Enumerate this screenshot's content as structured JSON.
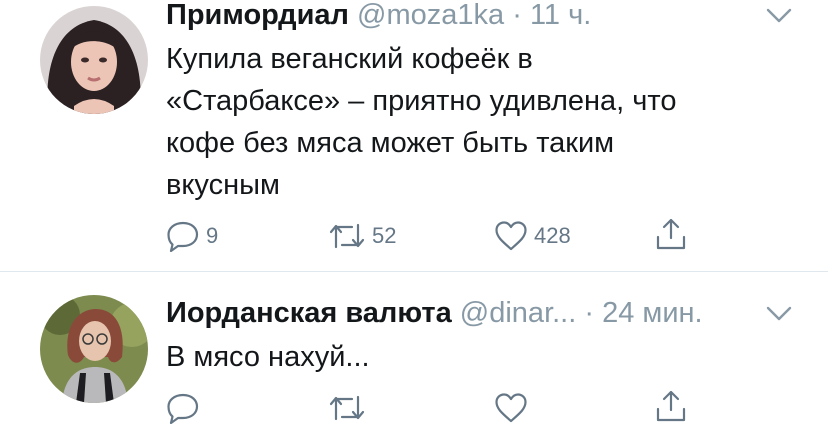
{
  "tweets": [
    {
      "author_name": "Примордиал",
      "handle": "@moza1ka",
      "separator": "·",
      "time": "11 ч.",
      "text_lines": [
        "Купила веганский кофеёк в",
        "«Старбаксе» – приятно удивлена, что",
        "кофе без мяса может быть таким",
        "вкусным"
      ],
      "actions": {
        "reply_count": "9",
        "retweet_count": "52",
        "like_count": "428"
      }
    },
    {
      "author_name": "Иорданская валюта",
      "handle": "@dinar...",
      "separator": "·",
      "time": "24 мин.",
      "text_lines": [
        "В мясо нахуй..."
      ],
      "actions": {
        "reply_count": "",
        "retweet_count": "",
        "like_count": ""
      }
    }
  ],
  "icons": {
    "reply": "reply-icon",
    "retweet": "retweet-icon",
    "like": "heart-icon",
    "share": "share-icon",
    "menu": "chevron-down-icon"
  },
  "colors": {
    "text": "#14171a",
    "secondary": "#8899a6",
    "icon": "#657786",
    "divider": "#e1e8ed"
  }
}
